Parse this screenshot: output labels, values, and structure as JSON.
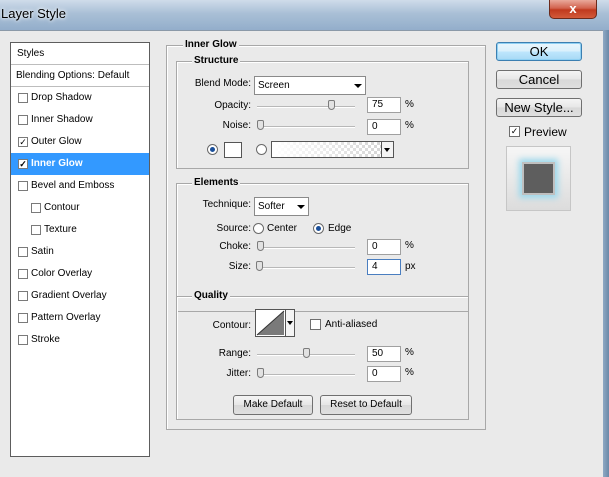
{
  "window": {
    "title": "Layer Style",
    "close_glyph": "x"
  },
  "styles_list": {
    "header": "Styles",
    "blending_options": "Blending Options: Default",
    "items": [
      {
        "label": "Drop Shadow",
        "checked": false,
        "selected": false,
        "sub": false
      },
      {
        "label": "Inner Shadow",
        "checked": false,
        "selected": false,
        "sub": false
      },
      {
        "label": "Outer Glow",
        "checked": true,
        "selected": false,
        "sub": false
      },
      {
        "label": "Inner Glow",
        "checked": true,
        "selected": true,
        "sub": false
      },
      {
        "label": "Bevel and Emboss",
        "checked": false,
        "selected": false,
        "sub": false
      },
      {
        "label": "Contour",
        "checked": false,
        "selected": false,
        "sub": true
      },
      {
        "label": "Texture",
        "checked": false,
        "selected": false,
        "sub": true
      },
      {
        "label": "Satin",
        "checked": false,
        "selected": false,
        "sub": false
      },
      {
        "label": "Color Overlay",
        "checked": false,
        "selected": false,
        "sub": false
      },
      {
        "label": "Gradient Overlay",
        "checked": false,
        "selected": false,
        "sub": false
      },
      {
        "label": "Pattern Overlay",
        "checked": false,
        "selected": false,
        "sub": false
      },
      {
        "label": "Stroke",
        "checked": false,
        "selected": false,
        "sub": false
      }
    ]
  },
  "inner_glow": {
    "title": "Inner Glow",
    "structure": {
      "title": "Structure",
      "blend_mode_label": "Blend Mode:",
      "blend_mode_value": "Screen",
      "opacity_label": "Opacity:",
      "opacity_value": "75",
      "opacity_percent": 75,
      "opacity_unit": "%",
      "noise_label": "Noise:",
      "noise_value": "0",
      "noise_percent": 0,
      "noise_unit": "%",
      "fill_mode": "color",
      "glow_color": "#ffffff"
    },
    "elements": {
      "title": "Elements",
      "technique_label": "Technique:",
      "technique_value": "Softer",
      "source_label": "Source:",
      "source_center": "Center",
      "source_edge": "Edge",
      "source_selected": "edge",
      "choke_label": "Choke:",
      "choke_value": "0",
      "choke_unit": "%",
      "choke_fraction": 0,
      "size_label": "Size:",
      "size_value": "4",
      "size_unit": "px",
      "size_fraction": 0.02
    },
    "quality": {
      "title": "Quality",
      "contour_label": "Contour:",
      "anti_aliased_label": "Anti-aliased",
      "anti_aliased_checked": false,
      "range_label": "Range:",
      "range_value": "50",
      "range_percent": 50,
      "range_unit": "%",
      "jitter_label": "Jitter:",
      "jitter_value": "0",
      "jitter_percent": 0,
      "jitter_unit": "%"
    },
    "make_default_label": "Make Default",
    "reset_default_label": "Reset to Default"
  },
  "buttons": {
    "ok": "OK",
    "cancel": "Cancel",
    "new_style": "New Style...",
    "preview_label": "Preview",
    "preview_checked": true
  }
}
